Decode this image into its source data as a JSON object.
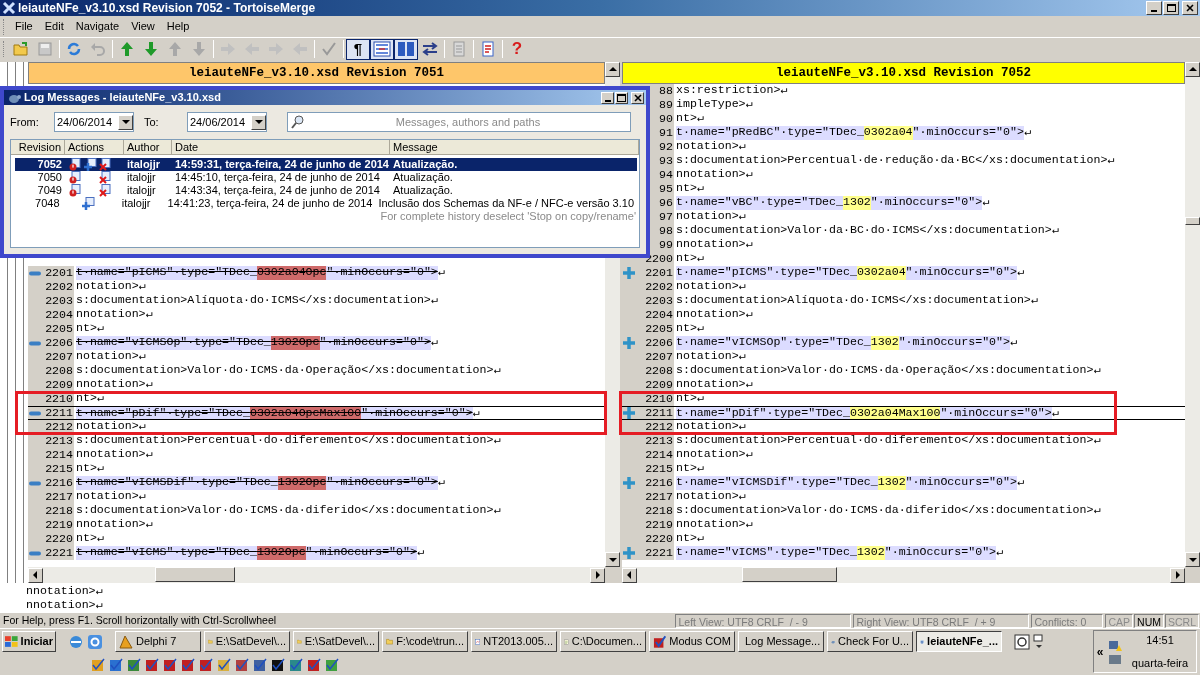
{
  "window": {
    "title": "leiauteNFe_v3.10.xsd Revision 7052 - TortoiseMerge"
  },
  "menu": [
    "File",
    "Edit",
    "Navigate",
    "View",
    "Help"
  ],
  "toolbar": [
    {
      "kind": "open",
      "disabled": false,
      "selected": false
    },
    {
      "kind": "save",
      "disabled": true,
      "selected": false
    },
    {
      "kind": "separator"
    },
    {
      "kind": "reload",
      "disabled": false,
      "selected": false
    },
    {
      "kind": "undo",
      "disabled": true,
      "selected": false
    },
    {
      "kind": "separator"
    },
    {
      "kind": "up",
      "disabled": false,
      "selected": false
    },
    {
      "kind": "down",
      "disabled": false,
      "selected": false
    },
    {
      "kind": "up",
      "disabled": true,
      "selected": false
    },
    {
      "kind": "down",
      "disabled": true,
      "selected": false
    },
    {
      "kind": "separator"
    },
    {
      "kind": "right",
      "disabled": true,
      "selected": false
    },
    {
      "kind": "left",
      "disabled": true,
      "selected": false
    },
    {
      "kind": "right",
      "disabled": true,
      "selected": false
    },
    {
      "kind": "left",
      "disabled": true,
      "selected": false
    },
    {
      "kind": "separator"
    },
    {
      "kind": "mark",
      "disabled": true,
      "selected": false
    },
    {
      "kind": "separator"
    },
    {
      "kind": "text",
      "label": "¶",
      "disabled": false,
      "selected": true
    },
    {
      "kind": "inline",
      "disabled": false,
      "selected": true
    },
    {
      "kind": "twopane",
      "disabled": false,
      "selected": true
    },
    {
      "kind": "swap",
      "disabled": false,
      "selected": false
    },
    {
      "kind": "separator"
    },
    {
      "kind": "doc",
      "disabled": true,
      "selected": false
    },
    {
      "kind": "separator"
    },
    {
      "kind": "check",
      "disabled": false,
      "selected": false
    },
    {
      "kind": "separator"
    },
    {
      "kind": "help",
      "label": "?",
      "disabled": false,
      "selected": false
    }
  ],
  "left_pane": {
    "title": "leiauteNFe_v3.10.xsd Revision 7051",
    "lines": [
      {
        "num": "2201",
        "kind": "removed",
        "current": false,
        "before": "t·name=\"pICMS\"·type=\"TDec_",
        "changed": "0302a04Opc",
        "after": "\"·minOccurs=\"0\">",
        "end": "↵"
      },
      {
        "num": "2202",
        "kind": "normal",
        "text": "notation>↵"
      },
      {
        "num": "2203",
        "kind": "normal",
        "text": "s:documentation>Alíquota·do·ICMS</xs:documentation>↵"
      },
      {
        "num": "2204",
        "kind": "normal",
        "text": "nnotation>↵"
      },
      {
        "num": "2205",
        "kind": "normal",
        "text": "nt>↵"
      },
      {
        "num": "2206",
        "kind": "removed",
        "current": false,
        "before": "t·name=\"vICMSOp\"·type=\"TDec_",
        "changed": "1302Opc",
        "after": "\"·minOccurs=\"0\">",
        "end": "↵"
      },
      {
        "num": "2207",
        "kind": "normal",
        "text": "notation>↵"
      },
      {
        "num": "2208",
        "kind": "normal",
        "text": "s:documentation>Valor·do·ICMS·da·Operação</xs:documentation>↵"
      },
      {
        "num": "2209",
        "kind": "normal",
        "text": "nnotation>↵"
      },
      {
        "num": "2210",
        "kind": "normal",
        "text": "nt>↵"
      },
      {
        "num": "2211",
        "kind": "removed",
        "current": true,
        "before": "t·name=\"pDif\"·type=\"TDec_",
        "changed": "0302a04OpcMax100",
        "after": "\"·minOccurs=\"0\">",
        "end": "↵"
      },
      {
        "num": "2212",
        "kind": "normal",
        "text": "notation>↵"
      },
      {
        "num": "2213",
        "kind": "normal",
        "text": "s:documentation>Percentual·do·diferemento</xs:documentation>↵"
      },
      {
        "num": "2214",
        "kind": "normal",
        "text": "nnotation>↵"
      },
      {
        "num": "2215",
        "kind": "normal",
        "text": "nt>↵"
      },
      {
        "num": "2216",
        "kind": "removed",
        "current": false,
        "before": "t·name=\"vICMSDif\"·type=\"TDec_",
        "changed": "1302Opc",
        "after": "\"·minOccurs=\"0\">",
        "end": "↵"
      },
      {
        "num": "2217",
        "kind": "normal",
        "text": "notation>↵"
      },
      {
        "num": "2218",
        "kind": "normal",
        "text": "s:documentation>Valor·do·ICMS·da·diferido</xs:documentation>↵"
      },
      {
        "num": "2219",
        "kind": "normal",
        "text": "nnotation>↵"
      },
      {
        "num": "2220",
        "kind": "normal",
        "text": "nt>↵"
      },
      {
        "num": "2221",
        "kind": "removed",
        "current": false,
        "before": "t·name=\"vICMS\"·type=\"TDec_",
        "changed": "1302Opc",
        "after": "\"·minOccurs=\"0\">",
        "end": "↵"
      }
    ]
  },
  "right_pane": {
    "title": "leiauteNFe_v3.10.xsd Revision 7052",
    "lines": [
      {
        "num": "88",
        "kind": "normal",
        "text": "xs:restriction>↵"
      },
      {
        "num": "89",
        "kind": "normal",
        "text": "impleType>↵"
      },
      {
        "num": "90",
        "kind": "normal",
        "text": "nt>↵"
      },
      {
        "num": "91",
        "kind": "added",
        "current": false,
        "before": "t·name=\"pRedBC\"·type=\"TDec_",
        "changed": "0302a04",
        "after": "\"·minOccurs=\"0\">",
        "end": "↵"
      },
      {
        "num": "92",
        "kind": "normal",
        "text": "notation>↵"
      },
      {
        "num": "93",
        "kind": "normal",
        "text": "s:documentation>Percentual·de·redução·da·BC</xs:documentation>↵"
      },
      {
        "num": "94",
        "kind": "normal",
        "text": "nnotation>↵"
      },
      {
        "num": "95",
        "kind": "normal",
        "text": "nt>↵"
      },
      {
        "num": "96",
        "kind": "added",
        "current": false,
        "before": "t·name=\"vBC\"·type=\"TDec_",
        "changed": "1302",
        "after": "\"·minOccurs=\"0\">",
        "end": "↵"
      },
      {
        "num": "97",
        "kind": "normal",
        "text": "notation>↵"
      },
      {
        "num": "98",
        "kind": "normal",
        "text": "s:documentation>Valor·da·BC·do·ICMS</xs:documentation>↵"
      },
      {
        "num": "99",
        "kind": "normal",
        "text": "nnotation>↵"
      },
      {
        "num": "2200",
        "kind": "normal",
        "text": "nt>↵"
      },
      {
        "num": "2201",
        "kind": "added",
        "current": false,
        "before": "t·name=\"pICMS\"·type=\"TDec_",
        "changed": "0302a04",
        "after": "\"·minOccurs=\"0\">",
        "end": "↵"
      },
      {
        "num": "2202",
        "kind": "normal",
        "text": "notation>↵"
      },
      {
        "num": "2203",
        "kind": "normal",
        "text": "s:documentation>Alíquota·do·ICMS</xs:documentation>↵"
      },
      {
        "num": "2204",
        "kind": "normal",
        "text": "nnotation>↵"
      },
      {
        "num": "2205",
        "kind": "normal",
        "text": "nt>↵"
      },
      {
        "num": "2206",
        "kind": "added",
        "current": false,
        "before": "t·name=\"vICMSOp\"·type=\"TDec_",
        "changed": "1302",
        "after": "\"·minOccurs=\"0\">",
        "end": "↵"
      },
      {
        "num": "2207",
        "kind": "normal",
        "text": "notation>↵"
      },
      {
        "num": "2208",
        "kind": "normal",
        "text": "s:documentation>Valor·do·ICMS·da·Operação</xs:documentation>↵"
      },
      {
        "num": "2209",
        "kind": "normal",
        "text": "nnotation>↵"
      },
      {
        "num": "2210",
        "kind": "normal",
        "text": "nt>↵"
      },
      {
        "num": "2211",
        "kind": "added",
        "current": true,
        "before": "t·name=\"pDif\"·type=\"TDec_",
        "changed": "0302a04Max100",
        "after": "\"·minOccurs=\"0\">",
        "end": "↵"
      },
      {
        "num": "2212",
        "kind": "normal",
        "text": "notation>↵"
      },
      {
        "num": "2213",
        "kind": "normal",
        "text": "s:documentation>Percentual·do·diferemento</xs:documentation>↵"
      },
      {
        "num": "2214",
        "kind": "normal",
        "text": "nnotation>↵"
      },
      {
        "num": "2215",
        "kind": "normal",
        "text": "nt>↵"
      },
      {
        "num": "2216",
        "kind": "added",
        "current": false,
        "before": "t·name=\"vICMSDif\"·type=\"TDec_",
        "changed": "1302",
        "after": "\"·minOccurs=\"0\">",
        "end": "↵"
      },
      {
        "num": "2217",
        "kind": "normal",
        "text": "notation>↵"
      },
      {
        "num": "2218",
        "kind": "normal",
        "text": "s:documentation>Valor·do·ICMS·da·diferido</xs:documentation>↵"
      },
      {
        "num": "2219",
        "kind": "normal",
        "text": "nnotation>↵"
      },
      {
        "num": "2220",
        "kind": "normal",
        "text": "nt>↵"
      },
      {
        "num": "2221",
        "kind": "added",
        "current": false,
        "before": "t·name=\"vICMS\"·type=\"TDec_",
        "changed": "1302",
        "after": "\"·minOccurs=\"0\">",
        "end": "↵"
      }
    ]
  },
  "bottom_pane": {
    "lines": [
      "nnotation>↵",
      "nnotation>↵"
    ]
  },
  "log_dialog": {
    "title": "Log Messages - leiauteNFe_v3.10.xsd",
    "from_label": "From:",
    "from": "24/06/2014",
    "to_label": "To:",
    "to": "24/06/2014",
    "search_placeholder": "Messages, authors and paths",
    "columns": [
      "Revision",
      "Actions",
      "Author",
      "Date",
      "Message"
    ],
    "rows": [
      {
        "revision": "7052",
        "modified": true,
        "added": true,
        "deleted": true,
        "author": "italojjr",
        "date": "14:59:31, terça-feira, 24 de junho de 2014",
        "message": "Atualização.",
        "selected": true
      },
      {
        "revision": "7050",
        "modified": true,
        "added": false,
        "deleted": true,
        "author": "italojjr",
        "date": "14:45:10, terça-feira, 24 de junho de 2014",
        "message": "Atualização.",
        "selected": false
      },
      {
        "revision": "7049",
        "modified": true,
        "added": false,
        "deleted": true,
        "author": "italojjr",
        "date": "14:43:34, terça-feira, 24 de junho de 2014",
        "message": "Atualização.",
        "selected": false
      },
      {
        "revision": "7048",
        "modified": false,
        "added": true,
        "deleted": false,
        "author": "italojjr",
        "date": "14:41:23, terça-feira, 24 de junho de 2014",
        "message": "Inclusão dos Schemas da NF-e / NFC-e versão 3.10",
        "selected": false
      }
    ],
    "note": "For complete history deselect 'Stop on copy/rename'"
  },
  "status_bar": {
    "help": "For Help, press F1. Scroll horizontally with Ctrl-Scrollwheel",
    "panels": [
      "Left View: UTF8 CRLF  / - 9",
      "Right View: UTF8 CRLF  / + 9",
      "Conflicts: 0"
    ],
    "indicators": [
      {
        "label": "CAP",
        "on": false
      },
      {
        "label": "NUM",
        "on": true
      },
      {
        "label": "SCRL",
        "on": false
      }
    ]
  },
  "taskbar": {
    "start": "Iniciar",
    "tasks": [
      {
        "kind": "delphi",
        "label": "Delphi 7",
        "selected": false
      },
      {
        "kind": "folder",
        "label": "E:\\SatDevel\\...",
        "selected": false
      },
      {
        "kind": "folder",
        "label": "E:\\SatDevel\\...",
        "selected": false
      },
      {
        "kind": "folder",
        "label": "F:\\code\\trun...",
        "selected": false
      },
      {
        "kind": "doc",
        "label": "NT2013.005...",
        "selected": false
      },
      {
        "kind": "notepad",
        "label": "C:\\Documen...",
        "selected": false
      },
      {
        "kind": "check",
        "label": "Modus COM",
        "selected": false
      },
      {
        "kind": "tortoise",
        "label": "Log Message...",
        "selected": false
      },
      {
        "kind": "tortoise",
        "label": "Check For U...",
        "selected": false
      },
      {
        "kind": "merge",
        "label": "leiauteNFe_...",
        "selected": true
      }
    ],
    "tray_toggle": "«",
    "time": "14:51",
    "day": "quarta-feira"
  }
}
